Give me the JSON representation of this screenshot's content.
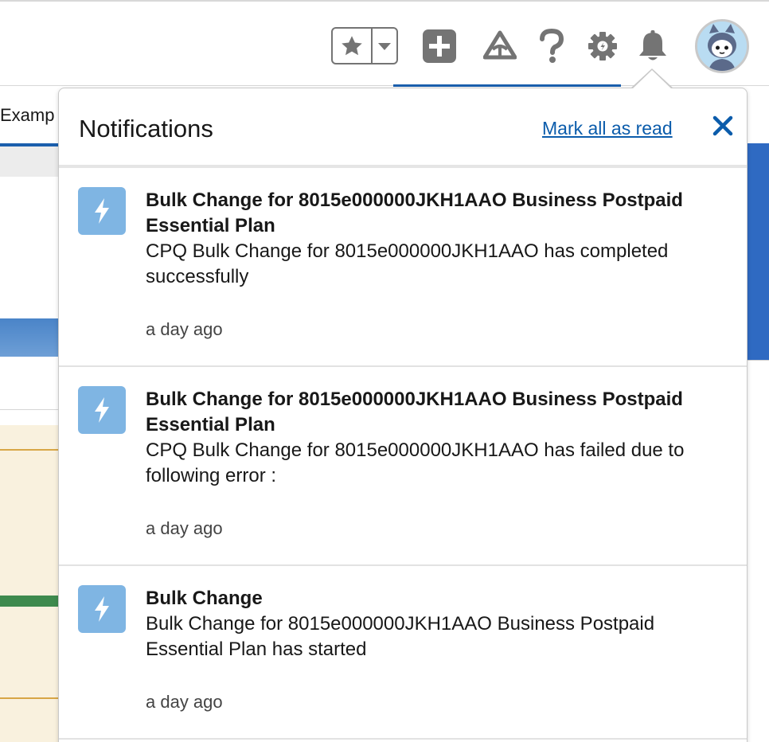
{
  "background": {
    "tab_label": "Examp"
  },
  "header": {
    "avatar_alt": "User avatar"
  },
  "notifications": {
    "title": "Notifications",
    "mark_all_read": "Mark all as read",
    "items": [
      {
        "title": "Bulk Change for 8015e000000JKH1AAO Business Postpaid Essential Plan",
        "body": "CPQ Bulk Change for 8015e000000JKH1AAO has completed successfully",
        "time": "a day ago"
      },
      {
        "title": "Bulk Change for 8015e000000JKH1AAO Business Postpaid Essential Plan",
        "body": "CPQ Bulk Change for 8015e000000JKH1AAO has failed due to following error :",
        "time": "a day ago"
      },
      {
        "title": "Bulk Change",
        "body": "Bulk Change for 8015e000000JKH1AAO Business Postpaid Essential Plan has started",
        "time": "a day ago"
      }
    ]
  },
  "colors": {
    "accent": "#0b5cab",
    "icon_bg": "#7fb5e3",
    "header_icon": "#747474"
  },
  "icons": {
    "favorites": "star-icon",
    "favorites_menu": "chevron-down-icon",
    "global_create": "plus-icon",
    "trailhead": "trailhead-icon",
    "help": "question-icon",
    "setup": "gear-icon",
    "notifications": "bell-icon",
    "notification_item": "lightning-bolt-icon",
    "close": "close-icon"
  }
}
